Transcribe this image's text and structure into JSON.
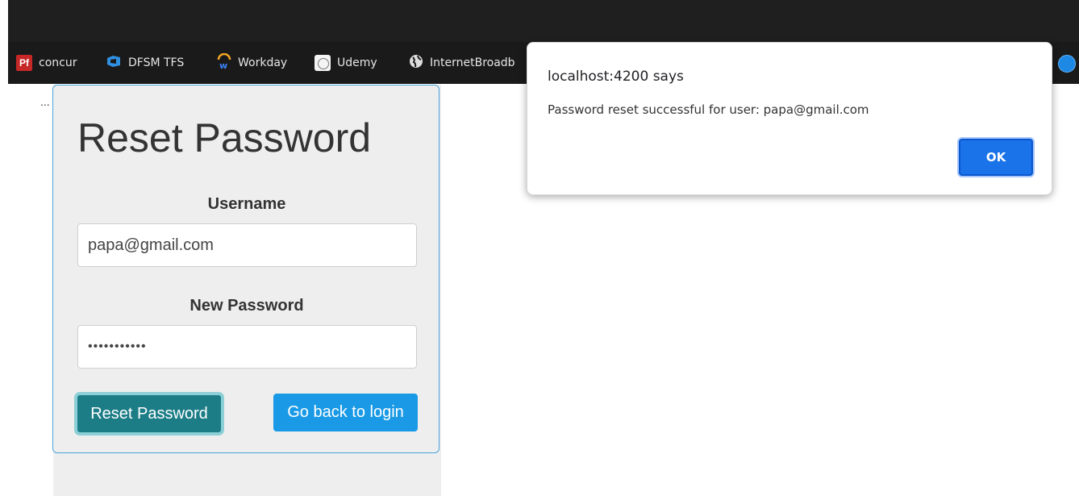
{
  "bookmarks": [
    {
      "label": "concur",
      "icon": "pf-icon"
    },
    {
      "label": "DFSM TFS",
      "icon": "dfsm-icon"
    },
    {
      "label": "Workday",
      "icon": "workday-icon"
    },
    {
      "label": "Udemy",
      "icon": "udemy-icon"
    },
    {
      "label": "InternetBroadb",
      "icon": "globe-icon"
    }
  ],
  "pf_icon_text": "Pf",
  "ellipsis": "...",
  "form": {
    "title": "Reset Password",
    "username_label": "Username",
    "username_value": "papa@gmail.com",
    "password_label": "New Password",
    "password_value": "•••••••••••",
    "reset_button": "Reset Password",
    "back_button": "Go back to login"
  },
  "dialog": {
    "title": "localhost:4200 says",
    "message": "Password reset successful for user: papa@gmail.com",
    "ok_label": "OK"
  },
  "colors": {
    "card_bg": "#eeeeee",
    "card_border": "#4aa3d8",
    "reset_btn": "#1c7d87",
    "back_btn": "#1a9ae6",
    "ok_btn": "#1a73e8"
  }
}
